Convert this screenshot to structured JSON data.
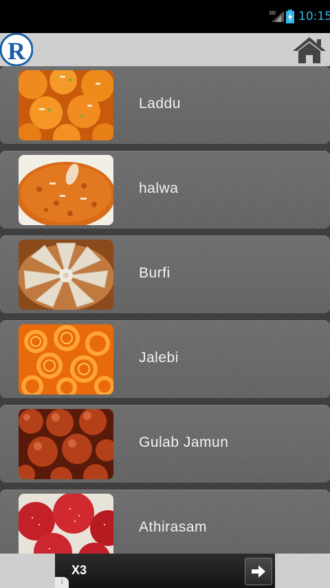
{
  "status_bar": {
    "network_label": "3G",
    "time": "10:15"
  },
  "action_bar": {
    "logo_letter": "R"
  },
  "items": [
    {
      "label": "Laddu"
    },
    {
      "label": "halwa"
    },
    {
      "label": "Burfi"
    },
    {
      "label": "Jalebi"
    },
    {
      "label": "Gulab Jamun"
    },
    {
      "label": "Athirasam"
    }
  ],
  "ad": {
    "text": "X3",
    "info_icon": "i"
  },
  "colors": {
    "status_accent": "#33b5e5",
    "logo_blue": "#1a5ea8",
    "action_bar_bg": "#cfcfcf"
  }
}
